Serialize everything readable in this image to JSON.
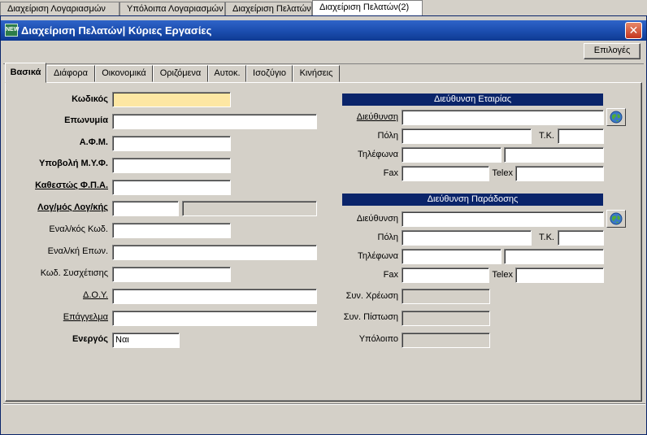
{
  "doc_tabs": [
    {
      "label": "Διαχείριση Λογαριασμών"
    },
    {
      "label": "Υπόλοιπα Λογαριασμών"
    },
    {
      "label": "Διαχείριση Πελατών"
    },
    {
      "label": "Διαχείριση Πελατών(2)"
    }
  ],
  "window": {
    "icon_text": "NEW",
    "title": "Διαχείριση Πελατών| Κύριες Εργασίες",
    "close_symbol": "✕",
    "options_label": "Επιλογές"
  },
  "form_tabs": [
    {
      "label": "Βασικά"
    },
    {
      "label": "Διάφορα"
    },
    {
      "label": "Οικονομικά"
    },
    {
      "label": "Οριζόμενα"
    },
    {
      "label": "Αυτοκ."
    },
    {
      "label": "Ισοζύγιο"
    },
    {
      "label": "Κινήσεις"
    }
  ],
  "left": {
    "code_label": "Κωδικός",
    "code_value": "",
    "name_label": "Επωνυμία",
    "name_value": "",
    "afm_label": "Α.Φ.Μ.",
    "afm_value": "",
    "myf_label": "Υποβολή Μ.Υ.Φ.",
    "myf_value": "",
    "vat_label": "Καθεστώς Φ.Π.Α.",
    "vat_value": "",
    "account_label": "Λογ/μός Λογ/κής",
    "account_value": "",
    "account_desc": "",
    "alt_code_label": "Εναλ/κός Κωδ.",
    "alt_code_value": "",
    "alt_name_label": "Εναλ/κή Επων.",
    "alt_name_value": "",
    "rel_code_label": "Κωδ. Συσχέτισης",
    "rel_code_value": "",
    "doy_label": "Δ.Ο.Υ.",
    "doy_value": "",
    "occupation_label": "Επάγγελμα",
    "occupation_value": "",
    "active_label": "Ενεργός",
    "active_value": "Ναι"
  },
  "company_address": {
    "header": "Διεύθυνση Εταιρίας",
    "address_label": "Διεύθυνση",
    "address_value": "",
    "city_label": "Πόλη",
    "city_value": "",
    "zip_label": "Τ.Κ.",
    "zip_value": "",
    "phones_label": "Τηλέφωνα",
    "phone1_value": "",
    "phone2_value": "",
    "fax_label": "Fax",
    "fax_value": "",
    "telex_label": "Telex",
    "telex_value": ""
  },
  "delivery_address": {
    "header": "Διεύθυνση Παράδοσης",
    "address_label": "Διεύθυνση",
    "address_value": "",
    "city_label": "Πόλη",
    "city_value": "",
    "zip_label": "Τ.Κ.",
    "zip_value": "",
    "phones_label": "Τηλέφωνα",
    "phone1_value": "",
    "phone2_value": "",
    "fax_label": "Fax",
    "fax_value": "",
    "telex_label": "Telex",
    "telex_value": ""
  },
  "balances": {
    "debit_label": "Συν. Χρέωση",
    "debit_value": "",
    "credit_label": "Συν. Πίστωση",
    "credit_value": "",
    "balance_label": "Υπόλοιπο",
    "balance_value": ""
  },
  "icons": {
    "globe": "globe-icon",
    "close": "close-icon"
  },
  "colors": {
    "title_bar": "#1d4fb1",
    "section_header": "#0a246a",
    "required_field": "#fde7a3",
    "close_button": "#c5361f"
  }
}
